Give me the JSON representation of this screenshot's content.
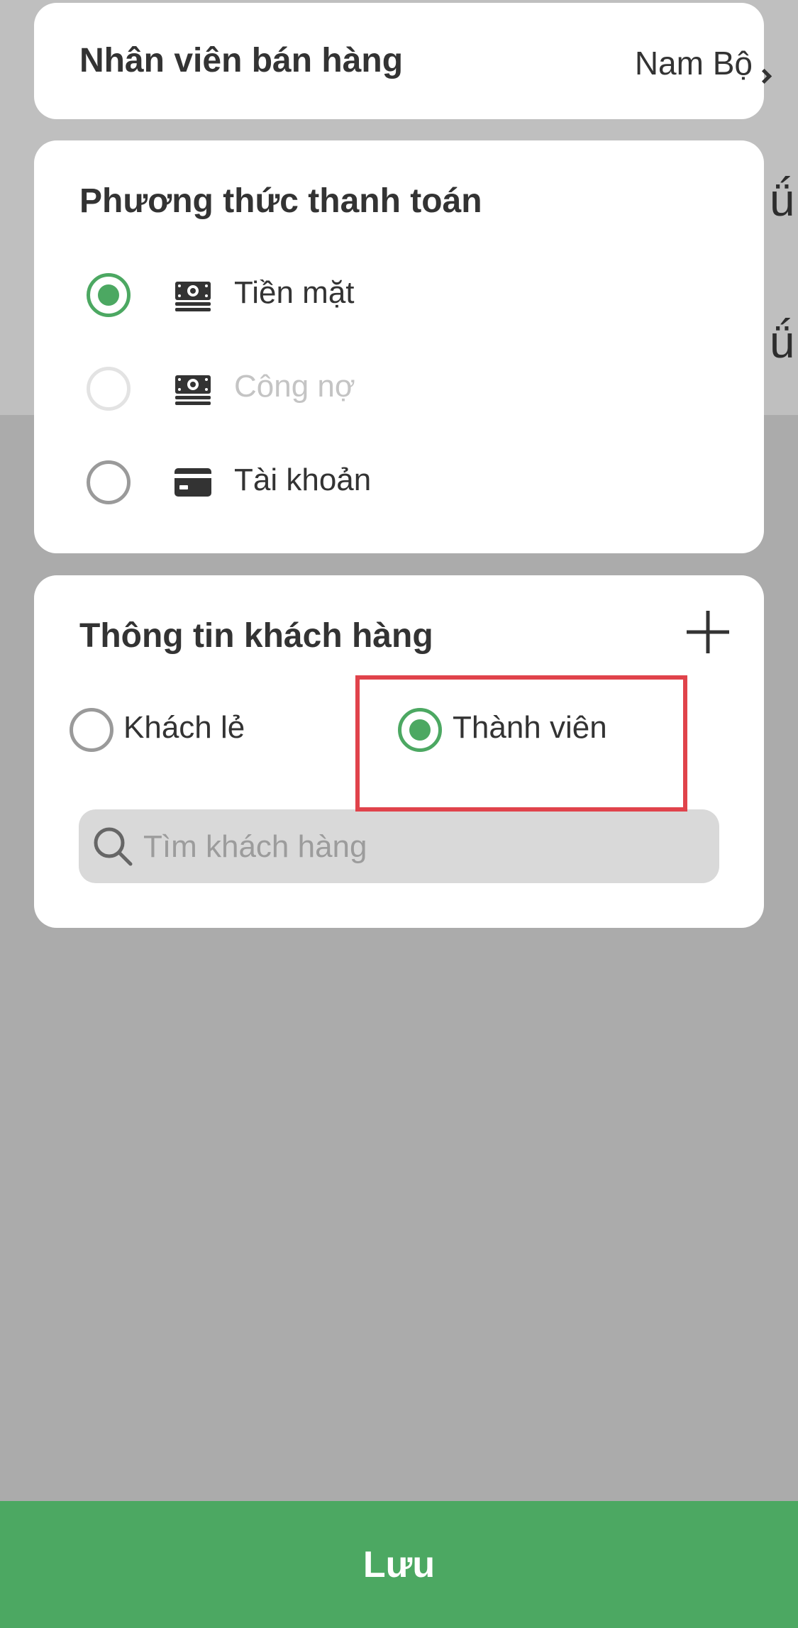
{
  "staff": {
    "label": "Nhân viên bán hàng",
    "value": "Nam Bộ"
  },
  "payment": {
    "title": "Phương thức thanh toán",
    "options": [
      {
        "label": "Tiền mặt",
        "icon": "cash-icon",
        "selected": true,
        "disabled": false
      },
      {
        "label": "Công nợ",
        "icon": "cash-icon",
        "selected": false,
        "disabled": true
      },
      {
        "label": "Tài khoản",
        "icon": "card-icon",
        "selected": false,
        "disabled": false
      }
    ]
  },
  "customer": {
    "title": "Thông tin khách hàng",
    "add_icon": "plus-icon",
    "types": [
      {
        "label": "Khách lẻ",
        "selected": false
      },
      {
        "label": "Thành viên",
        "selected": true
      }
    ],
    "search_placeholder": "Tìm khách hàng"
  },
  "footer": {
    "save_label": "Lưu"
  },
  "colors": {
    "accent": "#4ca862",
    "highlight": "#e0434b",
    "overlay": "#ababab"
  }
}
